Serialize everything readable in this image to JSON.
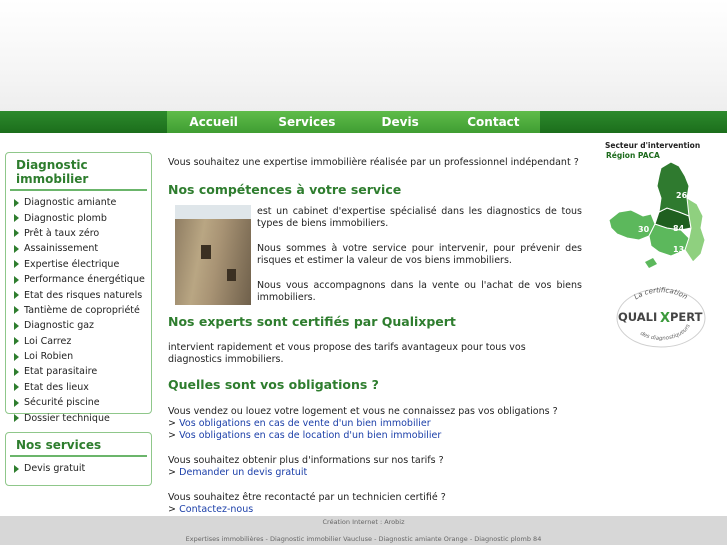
{
  "nav": {
    "items": [
      {
        "label": "Accueil"
      },
      {
        "label": "Services"
      },
      {
        "label": "Devis"
      },
      {
        "label": "Contact"
      }
    ]
  },
  "sidebar": {
    "diagnostic": {
      "title": "Diagnostic immobilier",
      "items": [
        {
          "label": "Diagnostic amiante"
        },
        {
          "label": "Diagnostic plomb"
        },
        {
          "label": "Prêt à taux zéro"
        },
        {
          "label": "Assainissement"
        },
        {
          "label": "Expertise électrique"
        },
        {
          "label": "Performance énergétique"
        },
        {
          "label": "Etat des risques naturels"
        },
        {
          "label": "Tantième de copropriété"
        },
        {
          "label": "Diagnostic gaz"
        },
        {
          "label": "Loi Carrez"
        },
        {
          "label": "Loi Robien"
        },
        {
          "label": "Etat parasitaire"
        },
        {
          "label": "Etat des lieux"
        },
        {
          "label": "Sécurité piscine"
        },
        {
          "label": "Dossier technique"
        }
      ]
    },
    "services": {
      "title": "Nos services",
      "items": [
        {
          "label": "Devis gratuit"
        }
      ]
    }
  },
  "main": {
    "intro": "Vous souhaitez une expertise immobilière réalisée par un professionnel indépendant ?",
    "competences_title": "Nos compétences à votre service",
    "p1": "est un cabinet d'expertise spécialisé dans les diagnostics de tous types de biens immobiliers.",
    "p2": "Nous sommes à votre service pour intervenir, pour prévenir des risques et estimer la valeur de vos biens immobiliers.",
    "p3": "Nous vous accompagnons dans la vente ou l'achat de vos biens immobiliers.",
    "experts_title": "Nos experts sont certifiés par Qualixpert",
    "p4": "intervient rapidement et vous propose des tarifs avantageux pour tous vos diagnostics immobiliers.",
    "obligations_title": "Quelles sont vos obligations ?",
    "q1": "Vous vendez ou louez votre logement et vous ne connaissez pas vos obligations ?",
    "link_vente": "Vos obligations en cas de vente d'un bien immobilier",
    "link_location": "Vos obligations en cas de location d'un bien immobilier",
    "q2": "Vous souhaitez obtenir plus d'informations sur nos tarifs ?",
    "link_devis": "Demander un devis gratuit",
    "q3": "Vous souhaitez être recontacté par un technicien certifié ?",
    "link_contact": "Contactez-nous",
    "arrow": ">"
  },
  "right": {
    "secteur": "Secteur d'intervention",
    "region": "Région PACA",
    "map_numbers": [
      "26",
      "30",
      "84",
      "13"
    ],
    "cert_arc_top": "La certification",
    "cert_logo_left": "QUALI",
    "cert_logo_x": "X",
    "cert_logo_right": "PERT",
    "cert_arc_bottom": "des diagnostiqueurs"
  },
  "footer": {
    "line1": "Création Internet : Arobiz",
    "line2": "Expertises immobilières - Diagnostic immobilier Vaucluse - Diagnostic amiante Orange - Diagnostic plomb 84"
  },
  "colors": {
    "nav_bar": "#1c6e1c",
    "nav_active": "#4fae3e",
    "heading_green": "#2e7d2e",
    "link_blue": "#1a3ea8",
    "map_light": "#5cb85c",
    "map_dark": "#1f5f1f"
  }
}
